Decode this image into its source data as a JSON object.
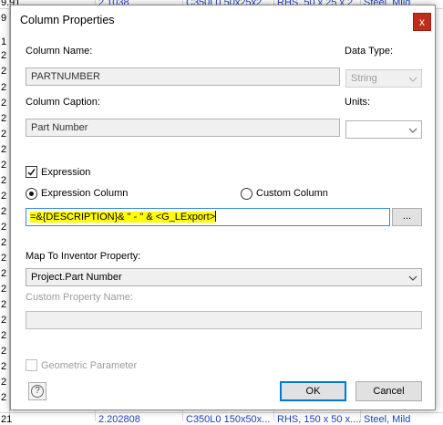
{
  "background": {
    "rows": [
      {
        "num": "9.91",
        "col1": "2.1038",
        "col2": "C350L0 50x25x2...",
        "col3": "RHS, 50 x 25 x 2....",
        "col4": "Steel, Mild"
      },
      {
        "num": "9",
        "col1": "",
        "col2": "",
        "col3": "",
        "col4": ""
      },
      {
        "num": "1",
        "col1": "",
        "col2": "",
        "col3": "",
        "col4": ""
      },
      {
        "num": "2",
        "col1": "",
        "col2": "",
        "col3": "",
        "col4": ""
      },
      {
        "num": "2",
        "col1": "",
        "col2": "",
        "col3": "",
        "col4": ""
      },
      {
        "num": "2",
        "col1": "",
        "col2": "",
        "col3": "",
        "col4": ""
      },
      {
        "num": "2",
        "col1": "",
        "col2": "",
        "col3": "",
        "col4": ""
      },
      {
        "num": "2",
        "col1": "",
        "col2": "",
        "col3": "",
        "col4": ""
      },
      {
        "num": "2",
        "col1": "",
        "col2": "",
        "col3": "",
        "col4": ""
      },
      {
        "num": "2",
        "col1": "",
        "col2": "",
        "col3": "",
        "col4": ""
      },
      {
        "num": "2",
        "col1": "",
        "col2": "",
        "col3": "",
        "col4": ""
      },
      {
        "num": "2",
        "col1": "",
        "col2": "",
        "col3": "",
        "col4": ""
      },
      {
        "num": "2",
        "col1": "",
        "col2": "",
        "col3": "",
        "col4": ""
      },
      {
        "num": "2",
        "col1": "",
        "col2": "",
        "col3": "",
        "col4": ""
      },
      {
        "num": "2",
        "col1": "",
        "col2": "",
        "col3": "",
        "col4": ""
      },
      {
        "num": "2",
        "col1": "",
        "col2": "",
        "col3": "",
        "col4": ""
      },
      {
        "num": "2",
        "col1": "",
        "col2": "",
        "col3": "",
        "col4": ""
      },
      {
        "num": "2",
        "col1": "",
        "col2": "",
        "col3": "",
        "col4": ""
      },
      {
        "num": "2",
        "col1": "",
        "col2": "",
        "col3": "",
        "col4": ""
      },
      {
        "num": "2",
        "col1": "",
        "col2": "",
        "col3": "",
        "col4": ""
      },
      {
        "num": "2",
        "col1": "",
        "col2": "",
        "col3": "",
        "col4": ""
      },
      {
        "num": "2",
        "col1": "",
        "col2": "",
        "col3": "",
        "col4": ""
      },
      {
        "num": "2",
        "col1": "",
        "col2": "",
        "col3": "",
        "col4": ""
      },
      {
        "num": "2",
        "col1": "",
        "col2": "",
        "col3": "",
        "col4": ""
      },
      {
        "num": "2",
        "col1": "",
        "col2": "",
        "col3": "",
        "col4": ""
      },
      {
        "num": "2",
        "col1": "",
        "col2": "",
        "col3": "",
        "col4": ""
      },
      {
        "num": "21",
        "col1": "2.202808",
        "col2": "C350L0 150x50x...",
        "col3": "RHS, 150 x 50 x....",
        "col4": "Steel, Mild"
      }
    ]
  },
  "dialog": {
    "title": "Column Properties",
    "close_icon": "close-icon",
    "close_glyph": "x",
    "column_name": {
      "label": "Column Name:",
      "value": "PARTNUMBER"
    },
    "data_type": {
      "label": "Data Type:",
      "value": "String"
    },
    "column_caption": {
      "label": "Column Caption:",
      "value": "Part Number"
    },
    "units": {
      "label": "Units:",
      "value": ""
    },
    "expression": {
      "label": "Expression",
      "checked": true
    },
    "expression_column": {
      "label": "Expression Column",
      "selected": true
    },
    "custom_column": {
      "label": "Custom Column",
      "selected": false
    },
    "expression_value": {
      "part1": "=&{DESCRIPTION}& \" - \" &",
      "part2": " <G_LExport>"
    },
    "browse_button": "...",
    "map_to_property": {
      "label": "Map To Inventor Property:",
      "value": "Project.Part Number"
    },
    "custom_property_name": {
      "label": "Custom Property Name:",
      "value": ""
    },
    "geometric_parameter": {
      "label": "Geometric Parameter",
      "checked": false
    },
    "help_icon": "help-icon",
    "help_glyph": "?",
    "ok_label": "OK",
    "cancel_label": "Cancel"
  }
}
